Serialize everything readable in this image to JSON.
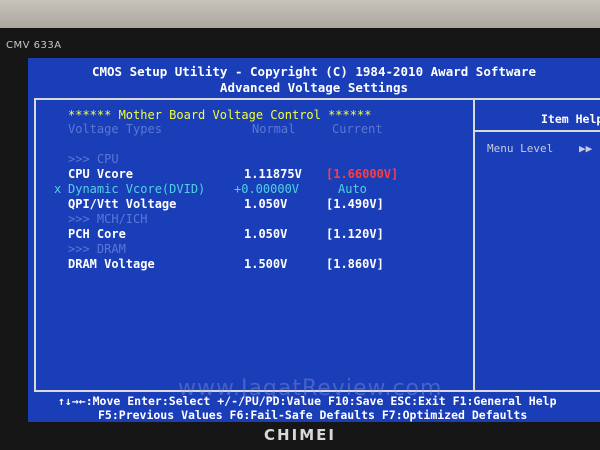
{
  "monitor": {
    "model_label": "CMV 633A",
    "brand": "CHIMEI"
  },
  "header": {
    "line1": "CMOS Setup Utility - Copyright (C) 1984-2010 Award Software",
    "line2": "Advanced Voltage Settings"
  },
  "section": {
    "title": "****** Mother Board Voltage Control ******",
    "col_types": "Voltage Types",
    "col_normal": "Normal",
    "col_current": "Current"
  },
  "groups": {
    "cpu": ">>> CPU",
    "mch": ">>> MCH/ICH",
    "dram": ">>> DRAM"
  },
  "items": {
    "cpu_vcore": {
      "label": "CPU Vcore",
      "normal": "1.11875V",
      "current": "[1.66000V]",
      "current_color": "#ff3d3d"
    },
    "dyn_vcore": {
      "marker": "x",
      "label": "Dynamic Vcore(DVID)",
      "normal": "+0.00000V",
      "current": "Auto"
    },
    "qpi_vtt": {
      "label": "QPI/Vtt Voltage",
      "normal": "1.050V",
      "current": "[1.490V]"
    },
    "pch_core": {
      "label": "PCH Core",
      "normal": "1.050V",
      "current": "[1.120V]"
    },
    "dram_voltage": {
      "label": "DRAM Voltage",
      "normal": "1.500V",
      "current": "[1.860V]"
    }
  },
  "help": {
    "title": "Item Help",
    "menu_level": "Menu Level",
    "arrows": "▶▶"
  },
  "footer": {
    "line1": "↑↓→←:Move  Enter:Select  +/-/PU/PD:Value  F10:Save  ESC:Exit  F1:General Help",
    "line2": "F5:Previous Values  F6:Fail-Safe Defaults  F7:Optimized Defaults"
  },
  "watermark": "www.JagatReview.com",
  "colors": {
    "screen_bg": "#1a3db8",
    "title_yellow": "#f3ff3b",
    "cyan": "#4fd2e6",
    "alert_red": "#ff3d3d"
  }
}
